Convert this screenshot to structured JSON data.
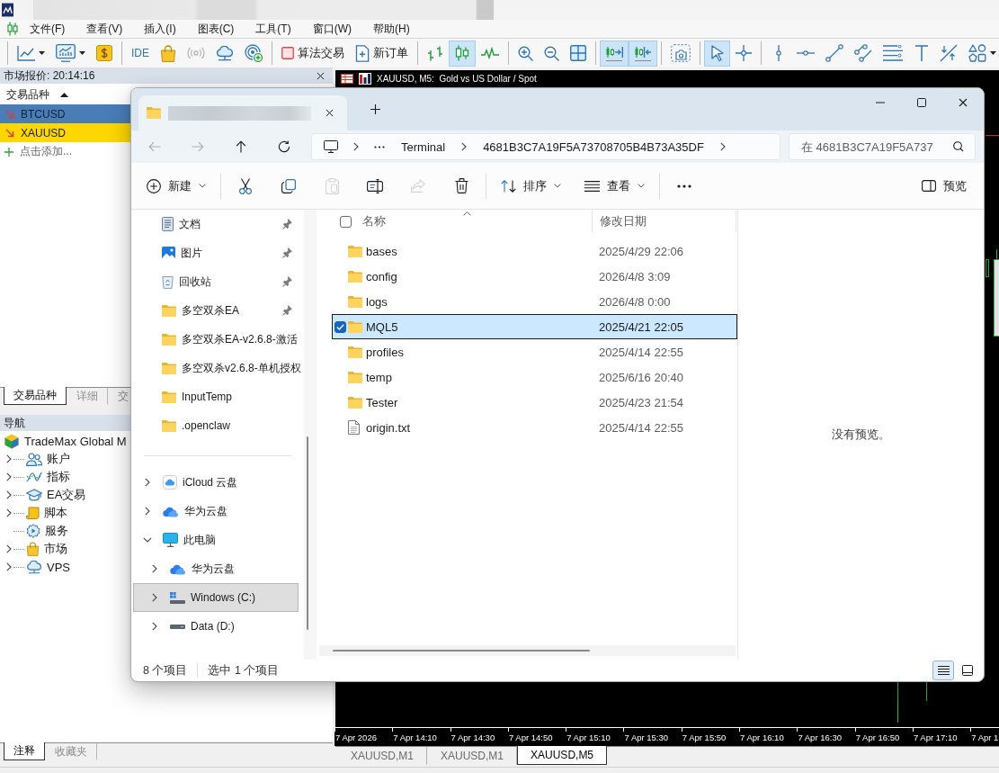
{
  "menu": [
    "文件(F)",
    "查看(V)",
    "插入(I)",
    "图表(C)",
    "工具(T)",
    "窗口(W)",
    "帮助(H)"
  ],
  "toolbar": [
    [
      {
        "kind": "line-chart",
        "selected": false,
        "dropdown": true
      },
      {
        "kind": "chart-window",
        "selected": false,
        "dropdown": true
      },
      {
        "kind": "dollar",
        "selected": false,
        "dropdown": false
      }
    ],
    [
      {
        "kind": "ide",
        "label": "IDE",
        "selected": false,
        "dropdown": false
      },
      {
        "kind": "bag",
        "selected": false,
        "dropdown": false
      },
      {
        "kind": "signal",
        "selected": false,
        "dropdown": false
      },
      {
        "kind": "cloud",
        "selected": false,
        "dropdown": false
      },
      {
        "kind": "radar-plus",
        "selected": false,
        "dropdown": false
      }
    ],
    [
      {
        "kind": "algo",
        "label": "算法交易",
        "selected": false,
        "dropdown": false
      },
      {
        "kind": "new-order",
        "label": "新订单",
        "selected": false,
        "dropdown": false
      }
    ],
    [
      {
        "kind": "bars",
        "selected": false,
        "dropdown": false
      },
      {
        "kind": "candles",
        "selected": true,
        "dropdown": false
      },
      {
        "kind": "line",
        "selected": false,
        "dropdown": false
      }
    ],
    [
      {
        "kind": "zoom-in",
        "selected": false,
        "dropdown": false
      },
      {
        "kind": "zoom-out",
        "selected": false,
        "dropdown": false
      },
      {
        "kind": "tile",
        "selected": false,
        "dropdown": false
      }
    ],
    [
      {
        "kind": "autoscroll",
        "selected": true,
        "dropdown": false
      },
      {
        "kind": "shift",
        "selected": true,
        "dropdown": false
      }
    ],
    [
      {
        "kind": "screenshot",
        "selected": false,
        "dropdown": false
      }
    ],
    [
      {
        "kind": "cursor",
        "selected": true,
        "dropdown": false
      },
      {
        "kind": "crosshair",
        "selected": false,
        "dropdown": false
      }
    ],
    [
      {
        "kind": "vline",
        "selected": false,
        "dropdown": false
      },
      {
        "kind": "hline",
        "selected": false,
        "dropdown": false
      },
      {
        "kind": "trend",
        "selected": false,
        "dropdown": false
      },
      {
        "kind": "channel",
        "selected": false,
        "dropdown": false
      },
      {
        "kind": "fibo",
        "selected": false,
        "dropdown": false
      },
      {
        "kind": "text",
        "selected": false,
        "dropdown": false
      },
      {
        "kind": "arrows",
        "selected": false,
        "dropdown": false
      },
      {
        "kind": "shapes",
        "selected": false,
        "dropdown": true
      }
    ]
  ],
  "market_watch": {
    "title": "市场报价: 20:14:16",
    "column": "交易品种",
    "rows": [
      {
        "symbol": "BTCUSD",
        "color": "#4a7db6"
      },
      {
        "symbol": "XAUUSD",
        "color": "#ffd700"
      }
    ],
    "add_hint": "点击添加...",
    "tabs": [
      {
        "label": "交易品种",
        "selected": true
      },
      {
        "label": "详细",
        "selected": false
      },
      {
        "label": "交",
        "selected": false
      }
    ]
  },
  "navigator": {
    "title": "导航",
    "root": {
      "label": "TradeMax Global M",
      "children": [
        {
          "label": "账户",
          "kind": "accounts",
          "expandable": true
        },
        {
          "label": "指标",
          "kind": "indicators",
          "expandable": true
        },
        {
          "label": "EA交易",
          "kind": "experts",
          "expandable": true
        },
        {
          "label": "脚本",
          "kind": "scripts",
          "expandable": true
        },
        {
          "label": "服务",
          "kind": "services",
          "expandable": false
        },
        {
          "label": "市场",
          "kind": "market",
          "expandable": true
        },
        {
          "label": "VPS",
          "kind": "vps",
          "expandable": true
        }
      ]
    }
  },
  "bottom_tabs": [
    {
      "label": "注释",
      "selected": true
    },
    {
      "label": "收藏夹",
      "selected": false
    }
  ],
  "chart": {
    "title": "XAUUSD, M5:  Gold vs US Dollar / Spot",
    "time_labels": [
      "7 Apr 2026",
      "7 Apr 14:10",
      "7 Apr 14:30",
      "7 Apr 14:50",
      "7 Apr 15:10",
      "7 Apr 15:30",
      "7 Apr 15:50",
      "7 Apr 16:10",
      "7 Apr 16:30",
      "7 Apr 16:50",
      "7 Apr 17:10",
      "7 Apr 1"
    ],
    "tabs": [
      {
        "label": "XAUUSD,M1",
        "selected": false
      },
      {
        "label": "XAUUSD,M1",
        "selected": false
      },
      {
        "label": "XAUUSD,M5",
        "selected": true
      }
    ]
  },
  "explorer": {
    "nav_buttons": [
      {
        "kind": "back",
        "disabled": true
      },
      {
        "kind": "forward",
        "disabled": true
      },
      {
        "kind": "up",
        "disabled": false
      },
      {
        "kind": "refresh",
        "disabled": false
      }
    ],
    "breadcrumb": [
      "Terminal",
      "4681B3C7A19F5A73708705B4B73A35DF"
    ],
    "search": {
      "placeholder": "在 4681B3C7A19F5A737"
    },
    "commands": [
      [
        {
          "kind": "new",
          "label": "新建",
          "dropdown": true,
          "disabled": false
        }
      ],
      [
        {
          "kind": "cut",
          "dropdown": false,
          "disabled": false
        },
        {
          "kind": "copy",
          "dropdown": false,
          "disabled": false
        },
        {
          "kind": "paste",
          "dropdown": false,
          "disabled": true
        },
        {
          "kind": "rename",
          "dropdown": false,
          "disabled": false
        },
        {
          "kind": "share",
          "dropdown": false,
          "disabled": true
        },
        {
          "kind": "delete",
          "dropdown": false,
          "disabled": false
        }
      ],
      [
        {
          "kind": "sort",
          "label": "排序",
          "dropdown": true,
          "disabled": false
        },
        {
          "kind": "view",
          "label": "查看",
          "dropdown": true,
          "disabled": false
        }
      ],
      [
        {
          "kind": "more",
          "dropdown": false,
          "disabled": false
        }
      ]
    ],
    "preview_toggle": "预览",
    "quick_access": [
      {
        "label": "文档",
        "kind": "documents",
        "pinned": true
      },
      {
        "label": "图片",
        "kind": "pictures",
        "pinned": true
      },
      {
        "label": "回收站",
        "kind": "recycle",
        "pinned": true
      },
      {
        "label": "多空双杀EA",
        "kind": "folder",
        "pinned": true
      },
      {
        "label": "多空双杀EA-v2.6.8-激活",
        "kind": "folder",
        "pinned": false
      },
      {
        "label": "多空双杀v2.6.8-单机授权",
        "kind": "folder",
        "pinned": false
      },
      {
        "label": "InputTemp",
        "kind": "folder",
        "pinned": false
      },
      {
        "label": ".openclaw",
        "kind": "folder",
        "pinned": false
      }
    ],
    "locations": [
      {
        "label": "iCloud 云盘",
        "kind": "icloud",
        "expanded": false,
        "selected": false
      },
      {
        "label": "华为云盘",
        "kind": "huawei",
        "expanded": false,
        "selected": false
      },
      {
        "label": "此电脑",
        "kind": "pc",
        "expanded": true,
        "selected": false,
        "children": [
          {
            "label": "华为云盘",
            "kind": "huawei",
            "expanded": false,
            "selected": false
          },
          {
            "label": "Windows (C:)",
            "kind": "system-drive",
            "expanded": false,
            "selected": true
          },
          {
            "label": "Data (D:)",
            "kind": "drive",
            "expanded": false,
            "selected": false
          }
        ]
      }
    ],
    "select_all": {
      "checked": false
    },
    "columns": [
      "名称",
      "修改日期"
    ],
    "files": [
      {
        "name": "bases",
        "modified": "2025/4/29 22:06",
        "kind": "folder",
        "selected": false
      },
      {
        "name": "config",
        "modified": "2026/4/8 3:09",
        "kind": "folder",
        "selected": false
      },
      {
        "name": "logs",
        "modified": "2026/4/8 0:00",
        "kind": "folder",
        "selected": false
      },
      {
        "name": "MQL5",
        "modified": "2025/4/21 22:05",
        "kind": "folder",
        "selected": true
      },
      {
        "name": "profiles",
        "modified": "2025/4/14 22:55",
        "kind": "folder",
        "selected": false
      },
      {
        "name": "temp",
        "modified": "2025/6/16 20:40",
        "kind": "folder",
        "selected": false
      },
      {
        "name": "Tester",
        "modified": "2025/4/23 21:54",
        "kind": "folder",
        "selected": false
      },
      {
        "name": "origin.txt",
        "modified": "2025/4/14 22:55",
        "kind": "text",
        "selected": false
      }
    ],
    "preview_message": "没有预览。",
    "status": {
      "count": "8 个项目",
      "selection": "选中 1 个项目"
    },
    "views": [
      {
        "kind": "details",
        "selected": true
      },
      {
        "kind": "tiles",
        "selected": false
      }
    ]
  }
}
